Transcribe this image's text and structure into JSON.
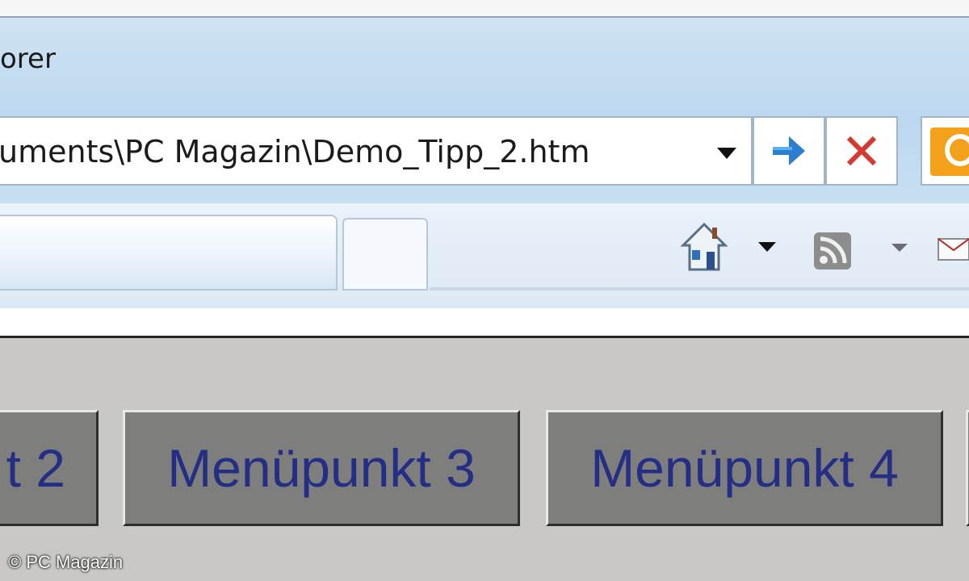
{
  "window": {
    "title_fragment": "orer"
  },
  "address_bar": {
    "value": "uments\\PC Magazin\\Demo_Tipp_2.htm"
  },
  "toolbar": {
    "go_icon": "arrow-right-icon",
    "stop_icon": "close-icon",
    "search_provider_icon": "bing-icon",
    "home_icon": "home-icon",
    "feeds_icon": "rss-icon",
    "mail_icon": "mail-icon"
  },
  "menu": {
    "items": [
      {
        "label": "t 2"
      },
      {
        "label": "Menüpunkt 3"
      },
      {
        "label": "Menüpunkt 4"
      }
    ]
  },
  "footer": {
    "copyright": "© PC Magazin"
  },
  "colors": {
    "menu_text": "#242e84",
    "menu_bg": "#7e7e7c",
    "page_bg": "#c9c8c4",
    "chrome_blue": "#bcd8ef",
    "go_arrow": "#2a7fd0",
    "stop_x": "#d43a2f",
    "bing_orange": "#f3a11a"
  }
}
